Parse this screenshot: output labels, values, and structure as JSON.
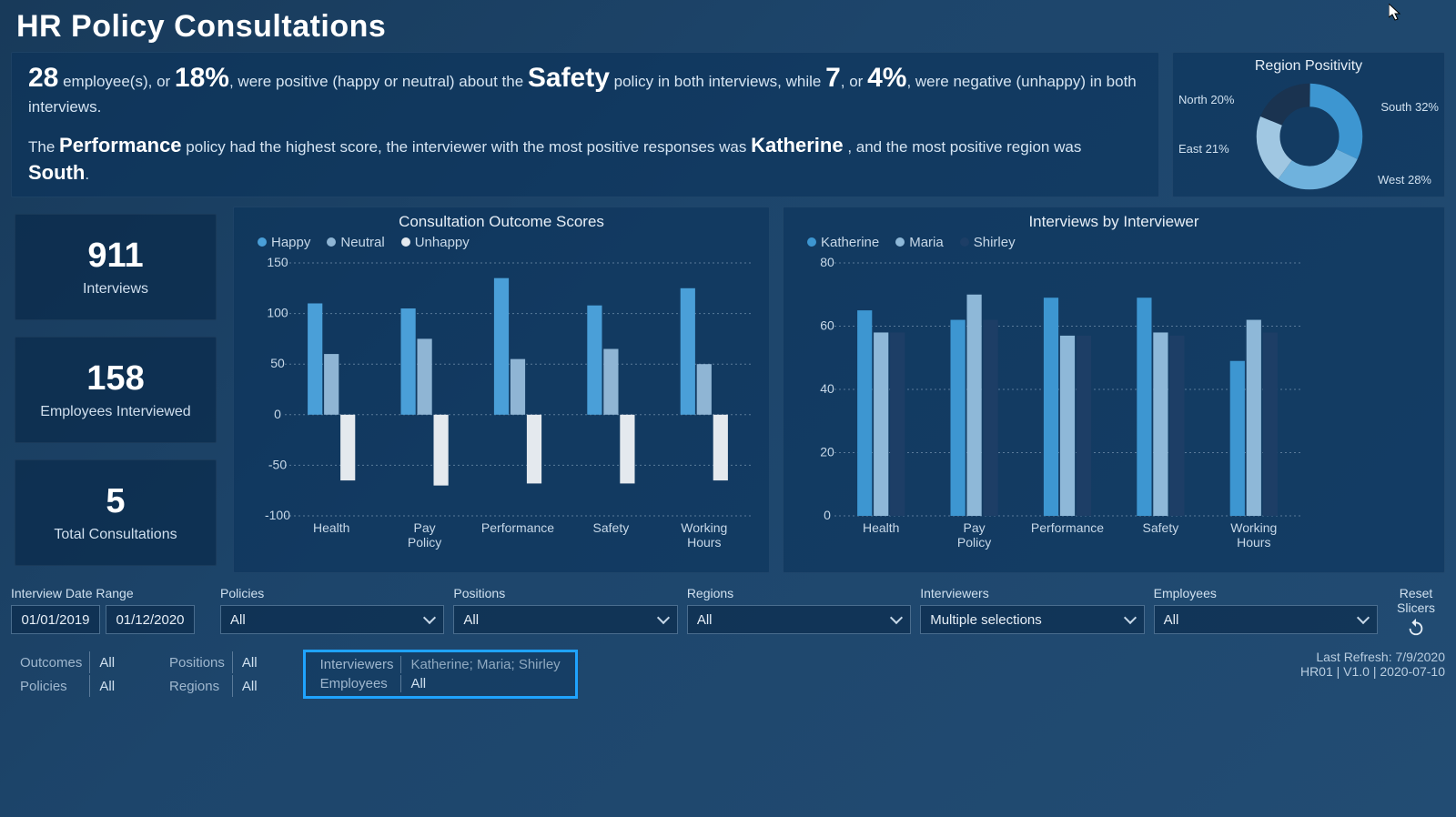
{
  "title": "HR Policy Consultations",
  "narrative": {
    "pos_count": "28",
    "pos_pct": "18%",
    "policy": "Safety",
    "neg_count": "7",
    "neg_pct": "4%",
    "top_policy": "Performance",
    "top_interviewer": "Katherine",
    "top_region": "South",
    "t1a": " employee(s), or ",
    "t1b": ", were positive (happy or neutral) about the ",
    "t1c": " policy in both interviews, while ",
    "t1d": ", or ",
    "t1e": ", were negative (unhappy) in both interviews.",
    "t2a": "The ",
    "t2b": " policy had the highest score, the interviewer with the most positive responses was ",
    "t2c": ", and the most positive region was ",
    "t2d": "."
  },
  "donut": {
    "title": "Region Positivity",
    "labels": {
      "north": "North 20%",
      "south": "South 32%",
      "east": "East 21%",
      "west": "West 28%"
    }
  },
  "kpis": [
    {
      "v": "911",
      "l": "Interviews"
    },
    {
      "v": "158",
      "l": "Employees Interviewed"
    },
    {
      "v": "5",
      "l": "Total Consultations"
    }
  ],
  "chart1": {
    "title": "Consultation Outcome Scores",
    "legend": [
      "Happy",
      "Neutral",
      "Unhappy"
    ]
  },
  "chart2": {
    "title": "Interviews by Interviewer",
    "legend": [
      "Katherine",
      "Maria",
      "Shirley"
    ]
  },
  "slicers": {
    "date_label": "Interview Date Range",
    "date_from": "01/01/2019",
    "date_to": "01/12/2020",
    "policies": {
      "label": "Policies",
      "value": "All"
    },
    "positions": {
      "label": "Positions",
      "value": "All"
    },
    "regions": {
      "label": "Regions",
      "value": "All"
    },
    "interviewers": {
      "label": "Interviewers",
      "value": "Multiple selections"
    },
    "employees": {
      "label": "Employees",
      "value": "All"
    },
    "reset": "Reset Slicers"
  },
  "footer": {
    "outcomes": {
      "k": "Outcomes",
      "v": "All"
    },
    "policies": {
      "k": "Policies",
      "v": "All"
    },
    "positions": {
      "k": "Positions",
      "v": "All"
    },
    "regions": {
      "k": "Regions",
      "v": "All"
    },
    "interviewers": {
      "k": "Interviewers",
      "v": "Katherine; Maria; Shirley"
    },
    "employees": {
      "k": "Employees",
      "v": "All"
    },
    "refresh": "Last Refresh: 7/9/2020",
    "version": "HR01 | V1.0 | 2020-07-10"
  },
  "colors": {
    "happy": "#4a9fd8",
    "neutral": "#8fb5d4",
    "unhappy": "#e4e9ee",
    "k": "#3d96d1",
    "m": "#8eb8d8",
    "s": "#1d3e66"
  },
  "chart_data": [
    {
      "type": "bar",
      "title": "Consultation Outcome Scores",
      "ylim": [
        -100,
        150
      ],
      "categories": [
        "Health",
        "Pay Policy",
        "Performance",
        "Safety",
        "Working Hours"
      ],
      "series": [
        {
          "name": "Happy",
          "values": [
            110,
            105,
            135,
            108,
            125
          ]
        },
        {
          "name": "Neutral",
          "values": [
            60,
            75,
            55,
            65,
            50
          ]
        },
        {
          "name": "Unhappy",
          "values": [
            -65,
            -70,
            -68,
            -68,
            -65
          ]
        }
      ]
    },
    {
      "type": "bar",
      "title": "Interviews by Interviewer",
      "ylim": [
        0,
        80
      ],
      "categories": [
        "Health",
        "Pay Policy",
        "Performance",
        "Safety",
        "Working Hours"
      ],
      "series": [
        {
          "name": "Katherine",
          "values": [
            65,
            62,
            69,
            69,
            49
          ]
        },
        {
          "name": "Maria",
          "values": [
            58,
            70,
            57,
            58,
            62
          ]
        },
        {
          "name": "Shirley",
          "values": [
            58,
            62,
            57,
            57,
            58
          ]
        }
      ]
    },
    {
      "type": "pie",
      "title": "Region Positivity",
      "categories": [
        "South",
        "West",
        "East",
        "North"
      ],
      "values": [
        32,
        28,
        21,
        20
      ]
    }
  ]
}
